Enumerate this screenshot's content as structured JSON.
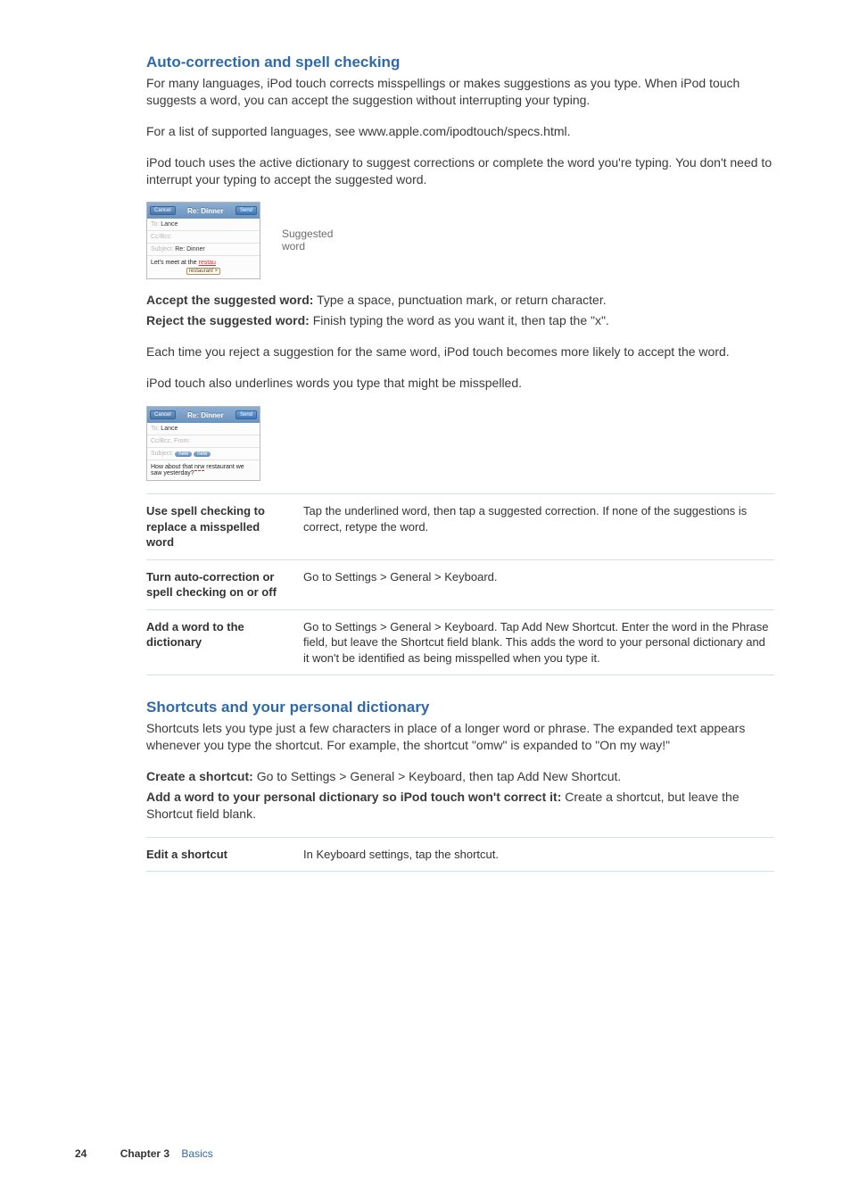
{
  "section1": {
    "heading": "Auto-correction and spell checking",
    "p1": "For many languages, iPod touch corrects misspellings or makes suggestions as you type. When iPod touch suggests a word, you can accept the suggestion without interrupting your typing.",
    "p2_pre": "For a list of supported languages, see ",
    "p2_link": "www.apple.com/ipodtouch/specs.html",
    "p2_post": ".",
    "p3": "iPod touch uses the active dictionary to suggest corrections or complete the word you're typing. You don't need to interrupt your typing to accept the suggested word."
  },
  "figure1": {
    "title": "Re: Dinner",
    "cancel": "Cancel",
    "send": "Send",
    "to_label": "To:",
    "to_value": "Lance",
    "ccbcc": "Cc/Bcc:",
    "subject_label": "Subject:",
    "subject_value": "Re: Dinner",
    "body_prefix": "Let's meet at the ",
    "typed_fragment": "restau",
    "suggestion": "restaurant ×",
    "callout1": "Suggested",
    "callout2": "word"
  },
  "mid": {
    "accept_label": "Accept the suggested word:",
    "accept_text": "  Type a space, punctuation mark, or return character.",
    "reject_label": "Reject the suggested word:",
    "reject_text": "  Finish typing the word as you want it, then tap the \"x\".",
    "p4": "Each time you reject a suggestion for the same word, iPod touch becomes more likely to accept the word.",
    "p5": "iPod touch also underlines words you type that might be misspelled."
  },
  "figure2": {
    "title": "Re: Dinner",
    "cancel": "Cancel",
    "send": "Send",
    "to_label": "To:",
    "to_value": "Lance",
    "ccbcc": "Cc/Bcc, From:",
    "subject_label": "Subject:",
    "chip1": "new",
    "chip2": "new",
    "body_pre": "How about that ",
    "body_under": "nrw",
    "body_post": " restaurant we saw yesterday?"
  },
  "table1": {
    "r1k": "Use spell checking to replace a misspelled word",
    "r1v": "Tap the underlined word, then tap a suggested correction. If none of the suggestions is correct, retype the word.",
    "r2k": "Turn auto-correction or spell checking on or off",
    "r2v": "Go to Settings > General > Keyboard.",
    "r3k": "Add a word to the dictionary",
    "r3v": "Go to Settings > General > Keyboard. Tap Add New Shortcut. Enter the word in the Phrase field, but leave the Shortcut field blank. This adds the word to your personal dictionary and it won't be identified as being misspelled when you type it."
  },
  "section2": {
    "heading": "Shortcuts and your personal dictionary",
    "p1": "Shortcuts lets you type just a few characters in place of a longer word or phrase. The expanded text appears whenever you type the shortcut. For example, the shortcut \"omw\" is expanded to \"On my way!\"",
    "create_label": "Create a shortcut:",
    "create_text": "  Go to Settings > General > Keyboard, then tap Add New Shortcut.",
    "add_label": "Add a word to your personal dictionary so iPod touch won't correct it:",
    "add_text": "  Create a shortcut, but leave the Shortcut field blank."
  },
  "table2": {
    "r1k": "Edit a shortcut",
    "r1v": "In Keyboard settings, tap the shortcut."
  },
  "footer": {
    "page": "24",
    "chapter": "Chapter 3",
    "name": "Basics"
  }
}
